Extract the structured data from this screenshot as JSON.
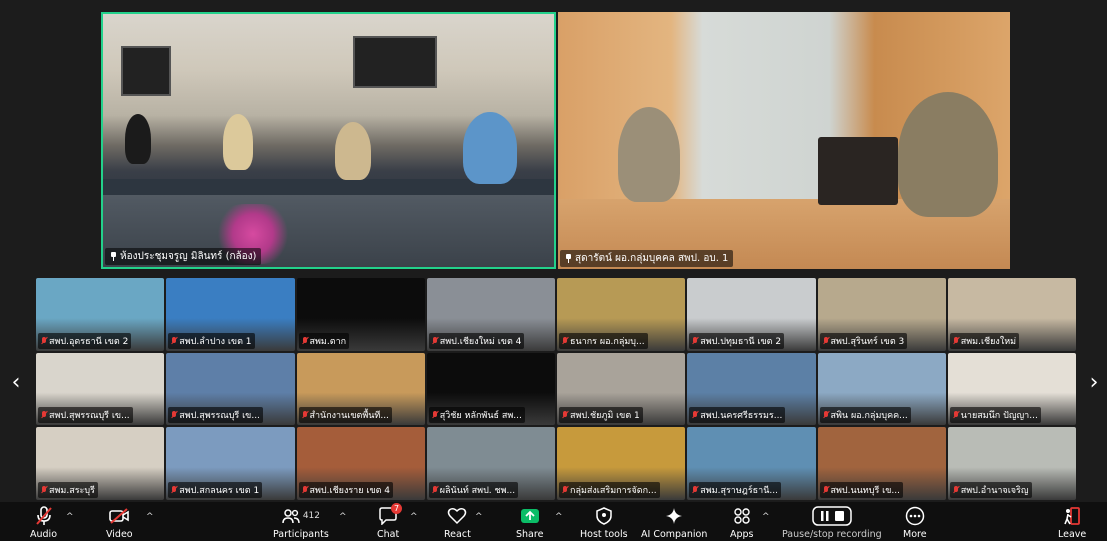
{
  "speakers": [
    {
      "name": "ห้องประชุมจรูญ มิลินทร์ (กล้อง)",
      "pinned": true
    },
    {
      "name": "สุดารัตน์ ผอ.กลุ่มบุคคล สพป. อบ. 1",
      "pinned": true
    }
  ],
  "tiles": [
    {
      "name": "สพป.อุดรธานี เขต 2",
      "bg": "#6aa7c4"
    },
    {
      "name": "สพป.ลำปาง เขต 1",
      "bg": "#3a7ec2"
    },
    {
      "name": "สพม.ตาก",
      "bg": "#0c0c0c"
    },
    {
      "name": "สพป.เชียงใหม่ เขต 4",
      "bg": "#8a8f96"
    },
    {
      "name": "ธนากร ผอ.กลุ่มบุ...",
      "bg": "#b79a55"
    },
    {
      "name": "สพป.ปทุมธานี เขต 2",
      "bg": "#c9ccce"
    },
    {
      "name": "สพป.สุรินทร์ เขต 3",
      "bg": "#b7a98d"
    },
    {
      "name": "สพม.เชียงใหม่",
      "bg": "#c7b9a2"
    },
    {
      "name": "สพป.สุพรรณบุรี เข...",
      "bg": "#d9d5cc"
    },
    {
      "name": "สพป.สุพรรณบุรี เข...",
      "bg": "#5e7fa8"
    },
    {
      "name": "สำนักงานเขตพื้นที...",
      "bg": "#c89a5b"
    },
    {
      "name": "สุวิชัย หลักพันธ์ สพ...",
      "bg": "#0c0c0c"
    },
    {
      "name": "สพป.ชัยภูมิ เขต 1",
      "bg": "#a9a39a"
    },
    {
      "name": "สพป.นครศรีธรรมร...",
      "bg": "#5c80a6"
    },
    {
      "name": "สพิน ผอ.กลุ่มบุคค...",
      "bg": "#8ca9c4"
    },
    {
      "name": "นายสมนึก ปัญญา...",
      "bg": "#e4dfd6"
    },
    {
      "name": "สพม.สระบุรี",
      "bg": "#d6cfc3"
    },
    {
      "name": "สพป.สกลนคร เขต 1",
      "bg": "#7c9bbf"
    },
    {
      "name": "สพป.เชียงราย เขต 4",
      "bg": "#a55d3a"
    },
    {
      "name": "ผลินันท์ สพป. ชพ...",
      "bg": "#7f8c93"
    },
    {
      "name": "กลุ่มส่งเสริมการจัดก...",
      "bg": "#c79a3c"
    },
    {
      "name": "สพม.สุราษฎร์ธานี...",
      "bg": "#5f8fb3"
    },
    {
      "name": "สพป.นนทบุรี เข...",
      "bg": "#a1643e"
    },
    {
      "name": "สพป.อำนาจเจริญ",
      "bg": "#b9bcb6"
    }
  ],
  "toolbar": {
    "audio": "Audio",
    "video": "Video",
    "participants": "Participants",
    "participants_count": "412",
    "chat": "Chat",
    "chat_badge": "7",
    "react": "React",
    "share": "Share",
    "host_tools": "Host tools",
    "ai_companion": "AI Companion",
    "apps": "Apps",
    "pause_recording": "Pause/stop recording",
    "more": "More",
    "leave": "Leave"
  },
  "colors": {
    "active_speaker_border": "#23d18b",
    "share_green": "#0bbd67",
    "leave_red": "#e53935"
  }
}
